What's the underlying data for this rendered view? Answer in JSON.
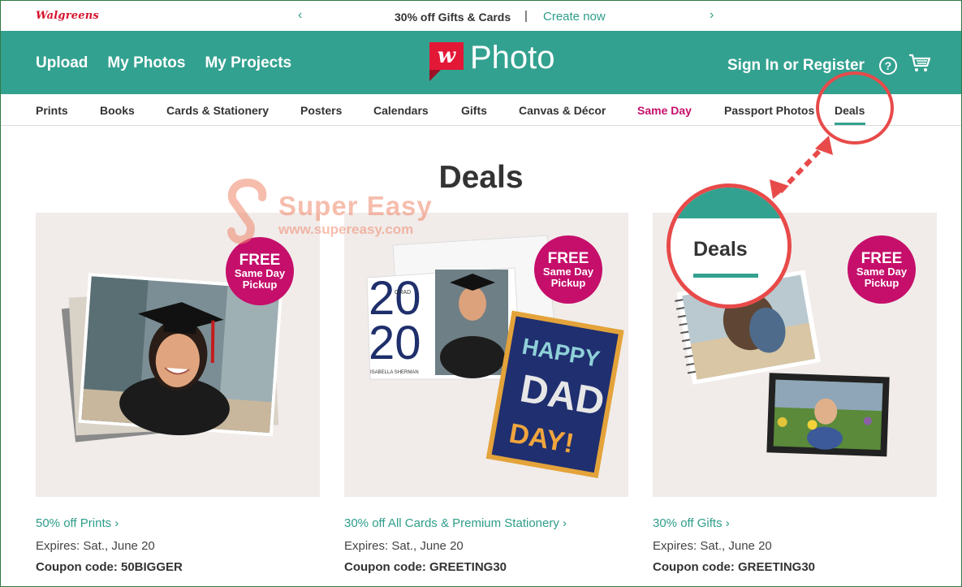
{
  "promo_bar": {
    "logo": "Walgreens",
    "message": "30% off Gifts & Cards",
    "separator": "|",
    "link": "Create now",
    "prev_arrow": "‹",
    "next_arrow": "›"
  },
  "header": {
    "nav": [
      "Upload",
      "My Photos",
      "My Projects"
    ],
    "brand_letter": "w",
    "brand_word": "Photo",
    "signin": "Sign In or Register",
    "help_symbol": "?"
  },
  "categories": [
    "Prints",
    "Books",
    "Cards & Stationery",
    "Posters",
    "Calendars",
    "Gifts",
    "Canvas & Décor",
    "Same Day",
    "Passport Photos",
    "Deals"
  ],
  "page_title": "Deals",
  "watermark": {
    "name": "Super Easy",
    "url": "www.supereasy.com"
  },
  "badge": {
    "line1": "FREE",
    "line2": "Same Day",
    "line3": "Pickup"
  },
  "deals": [
    {
      "title": "50% off Prints ›",
      "expires": "Expires: Sat., June 20",
      "coupon": "Coupon code: 50BIGGER"
    },
    {
      "title": "30% off All Cards & Premium Stationery ›",
      "expires": "Expires: Sat., June 20",
      "coupon": "Coupon code: GREETING30"
    },
    {
      "title": "30% off Gifts ›",
      "expires": "Expires: Sat., June 20",
      "coupon": "Coupon code: GREETING30"
    }
  ],
  "card_art": {
    "grad_year_top": "20",
    "grad_year_bottom": "20",
    "grad_label": "GRAD",
    "grad_name": "ISABELLA SHERMAN",
    "fathers_day": [
      "HAPPY",
      "DAD",
      "DAY!"
    ]
  },
  "annotation": {
    "zoom_label": "Deals"
  },
  "colors": {
    "teal": "#33a190",
    "magenta": "#c50f6b",
    "walgreens_red": "#e31837",
    "annotation_red": "#e84a4a"
  }
}
